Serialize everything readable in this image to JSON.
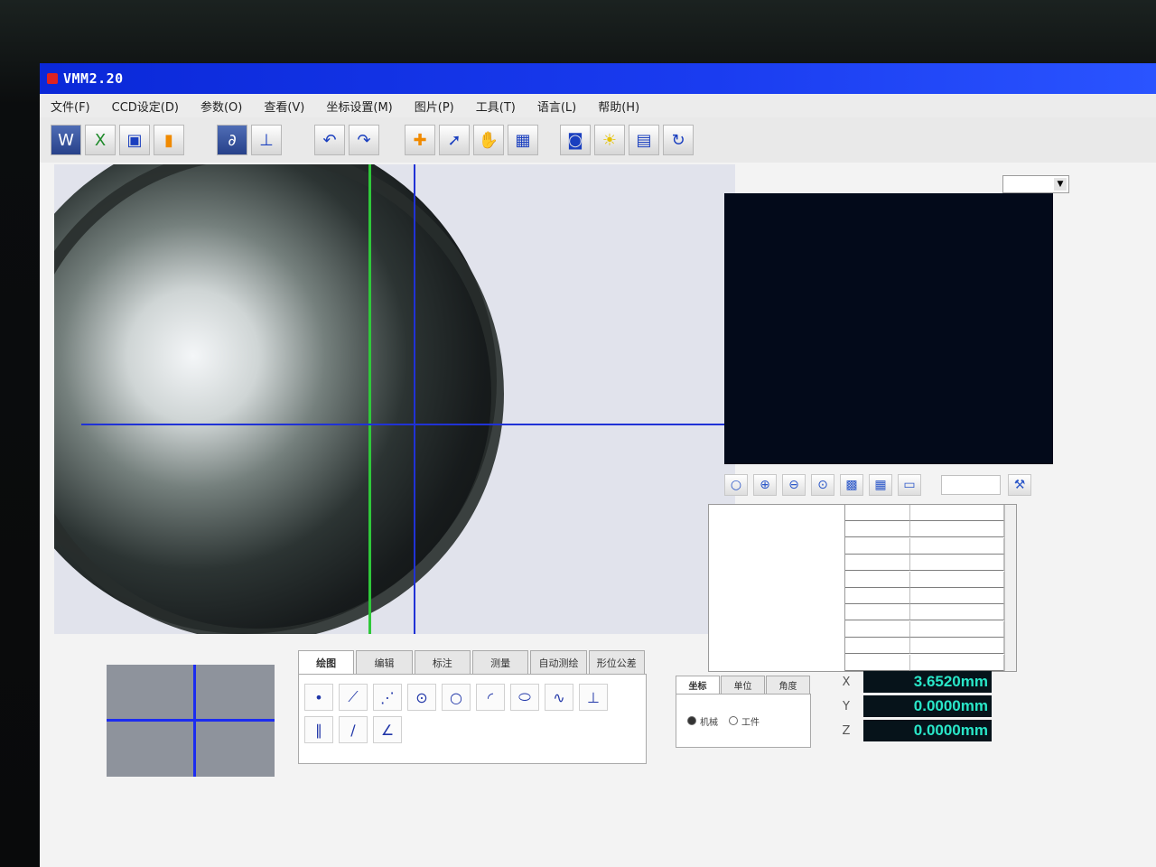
{
  "window": {
    "title": "VMM2.20"
  },
  "menu": [
    "文件(F)",
    "CCD设定(D)",
    "参数(O)",
    "查看(V)",
    "坐标设置(M)",
    "图片(P)",
    "工具(T)",
    "语言(L)",
    "帮助(H)"
  ],
  "toolbar": {
    "groups": [
      [
        {
          "icon": "word-export-icon",
          "glyph": "W"
        },
        {
          "icon": "excel-export-icon",
          "glyph": "X"
        },
        {
          "icon": "save-icon",
          "glyph": "▣"
        },
        {
          "icon": "report-chart-icon",
          "glyph": "▮"
        }
      ],
      [
        {
          "icon": "measure-mode-icon",
          "glyph": "∂"
        },
        {
          "icon": "coordinate-axis-icon",
          "glyph": "⊥"
        }
      ],
      [
        {
          "icon": "undo-icon",
          "glyph": "↶"
        },
        {
          "icon": "redo-icon",
          "glyph": "↷"
        }
      ],
      [
        {
          "icon": "crosshair-icon",
          "glyph": "✚"
        },
        {
          "icon": "probe-icon",
          "glyph": "➚"
        },
        {
          "icon": "hand-pan-icon",
          "glyph": "✋"
        },
        {
          "icon": "grid-icon",
          "glyph": "▦"
        }
      ],
      [
        {
          "icon": "camera-icon",
          "glyph": "◙"
        },
        {
          "icon": "light-bulb-icon",
          "glyph": "☀"
        },
        {
          "icon": "window-settings-icon",
          "glyph": "▤"
        },
        {
          "icon": "rotation-icon",
          "glyph": "↻"
        }
      ]
    ]
  },
  "preview_tools": [
    {
      "icon": "circle-select-icon",
      "glyph": "○"
    },
    {
      "icon": "zoom-in-icon",
      "glyph": "⊕"
    },
    {
      "icon": "zoom-out-icon",
      "glyph": "⊖"
    },
    {
      "icon": "zoom-fit-icon",
      "glyph": "⊙"
    },
    {
      "icon": "clear-icon",
      "glyph": "▩"
    },
    {
      "icon": "layout-grid-icon",
      "glyph": "▦"
    },
    {
      "icon": "fill-icon",
      "glyph": "▭"
    }
  ],
  "draw_tabs": [
    "绘图",
    "编辑",
    "标注",
    "测量",
    "自动测绘",
    "形位公差"
  ],
  "draw_tools": [
    {
      "icon": "point-icon",
      "glyph": "•"
    },
    {
      "icon": "line-icon",
      "glyph": "⟋"
    },
    {
      "icon": "multi-point-line-icon",
      "glyph": "⋰"
    },
    {
      "icon": "circle-center-icon",
      "glyph": "⊙"
    },
    {
      "icon": "circle-icon",
      "glyph": "○"
    },
    {
      "icon": "arc-icon",
      "glyph": "◜"
    },
    {
      "icon": "ellipse-icon",
      "glyph": "⬭"
    },
    {
      "icon": "curve-icon",
      "glyph": "∿"
    },
    {
      "icon": "perpendicular-icon",
      "glyph": "⊥"
    },
    {
      "icon": "parallel-lines-icon",
      "glyph": "∥"
    },
    {
      "icon": "slant-line-icon",
      "glyph": "∕"
    },
    {
      "icon": "angle-icon",
      "glyph": "∠"
    }
  ],
  "coord_tabs": [
    "坐标",
    "单位",
    "角度"
  ],
  "coord_modes": {
    "machine": "机械",
    "workpiece": "工件"
  },
  "readouts": [
    {
      "axis": "X",
      "value": "3.6520mm"
    },
    {
      "axis": "Y",
      "value": "0.0000mm"
    },
    {
      "axis": "Z",
      "value": "0.0000mm"
    }
  ],
  "colors": {
    "titlebar": "#1a3cf0",
    "crosshair_green": "#2fc83a",
    "crosshair_blue": "#2032d6",
    "readout_text": "#29e6c8",
    "readout_bg": "#06131a"
  }
}
